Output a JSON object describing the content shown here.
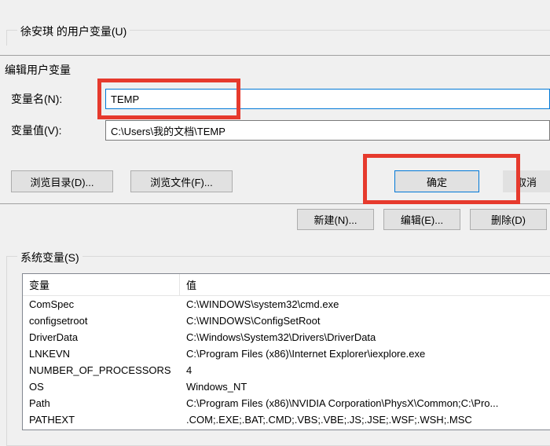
{
  "user_group": {
    "label": "徐安琪 的用户变量(U)"
  },
  "user_buttons": {
    "new": "新建(N)...",
    "edit": "编辑(E)...",
    "delete": "删除(D)"
  },
  "sys_group": {
    "label": "系统变量(S)"
  },
  "sys_list": {
    "col_var": "变量",
    "col_val": "值",
    "rows": [
      {
        "var": "ComSpec",
        "val": "C:\\WINDOWS\\system32\\cmd.exe"
      },
      {
        "var": "configsetroot",
        "val": "C:\\WINDOWS\\ConfigSetRoot"
      },
      {
        "var": "DriverData",
        "val": "C:\\Windows\\System32\\Drivers\\DriverData"
      },
      {
        "var": "LNKEVN",
        "val": "C:\\Program Files (x86)\\Internet Explorer\\iexplore.exe"
      },
      {
        "var": "NUMBER_OF_PROCESSORS",
        "val": "4"
      },
      {
        "var": "OS",
        "val": "Windows_NT"
      },
      {
        "var": "Path",
        "val": "C:\\Program Files (x86)\\NVIDIA Corporation\\PhysX\\Common;C:\\Pro..."
      },
      {
        "var": "PATHEXT",
        "val": ".COM;.EXE;.BAT;.CMD;.VBS;.VBE;.JS;.JSE;.WSF;.WSH;.MSC"
      }
    ]
  },
  "dialog": {
    "title": "编辑用户变量",
    "name_label": "变量名(N):",
    "name_value": "TEMP",
    "value_label": "变量值(V):",
    "value_value": "C:\\Users\\我的文档\\TEMP",
    "browse_dir": "浏览目录(D)...",
    "browse_file": "浏览文件(F)...",
    "ok": "确定",
    "cancel": "取消"
  }
}
